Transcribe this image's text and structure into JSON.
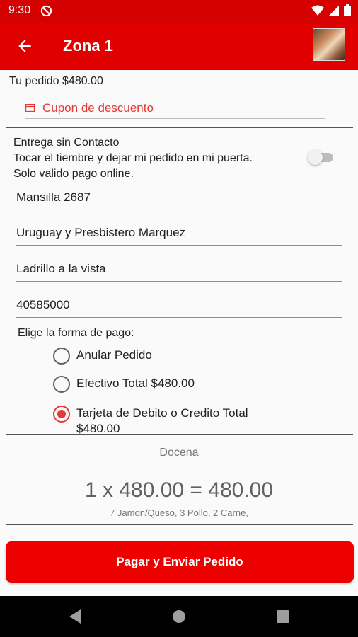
{
  "status_bar": {
    "time": "9:30"
  },
  "app_bar": {
    "title": "Zona 1"
  },
  "order": {
    "total_text": "Tu pedido $480.00"
  },
  "coupon": {
    "label": "Cupon de descuento"
  },
  "contactless": {
    "line1": "Entrega sin Contacto",
    "line2": "Tocar el tiembre y dejar mi pedido en mi puerta.",
    "line3": "Solo valido pago online.",
    "enabled": false
  },
  "address": {
    "street": "Mansilla 2687",
    "cross_streets": "Uruguay y Presbistero Marquez",
    "reference": "Ladrillo a la vista",
    "phone": "40585000"
  },
  "payment": {
    "label": "Elige la forma de pago:",
    "options": [
      {
        "label": "Anular Pedido",
        "selected": false
      },
      {
        "label": "Efectivo Total $480.00",
        "selected": false
      },
      {
        "label": "Tarjeta de Debito o Credito Total $480.00",
        "selected": true
      }
    ]
  },
  "product": {
    "name": "Docena",
    "calc": "1 x 480.00 = 480.00",
    "description": "7 Jamon/Queso, 3 Pollo, 2 Carne,"
  },
  "submit_button": {
    "label": "Pagar y Enviar Pedido"
  },
  "colors": {
    "primary": "#e10000",
    "accent": "#e53935",
    "status_bar": "#d50000"
  }
}
